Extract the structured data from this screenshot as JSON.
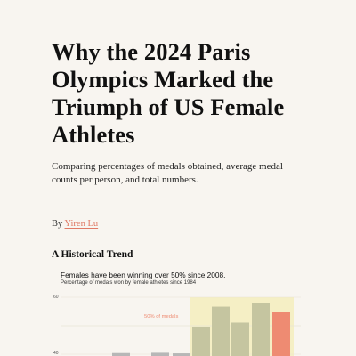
{
  "article": {
    "headline": "Why the 2024 Paris Olympics Marked the Triumph of US Female Athletes",
    "dek": "Comparing percentages of medals obtained, average medal counts per person, and total numbers.",
    "byline_prefix": "By",
    "author": "Yiren Lu"
  },
  "section": {
    "title": "A Historical Trend"
  },
  "chart": {
    "title": "Females have been winning over 50% since 2008.",
    "subtitle": "Percentage of medals won by female athletes since 1984",
    "annotation": "50% of medals",
    "colors": {
      "highlight_band": "#f5efc5",
      "bar_default": "#b7b7b7",
      "bar_over_50": "#c5c5a0",
      "bar_2024": "#ee8b72",
      "reference_line": "#e9e4d5"
    }
  },
  "chart_data": {
    "type": "bar",
    "title": "Females have been winning over 50% since 2008.",
    "subtitle": "Percentage of medals won by female athletes since 1984",
    "ylim": [
      40,
      60
    ],
    "yticks": [
      40,
      60
    ],
    "reference_value": 50,
    "reference_label": "50% of medals",
    "categories": [
      "",
      "",
      "",
      "",
      "",
      "",
      "",
      "",
      "",
      "",
      "",
      ""
    ],
    "values": [
      null,
      null,
      null,
      null,
      40.4,
      null,
      40.5,
      40.3,
      49.7,
      56.7,
      51.1,
      58.1,
      54.9
    ],
    "bars": [
      {
        "category": "",
        "value": 40.4,
        "group": "default"
      },
      {
        "category": "",
        "value": 40.5,
        "group": "default"
      },
      {
        "category": "",
        "value": 40.3,
        "group": "default"
      },
      {
        "category": "",
        "value": 49.7,
        "group": "over_50"
      },
      {
        "category": "",
        "value": 56.7,
        "group": "over_50"
      },
      {
        "category": "",
        "value": 51.1,
        "group": "over_50"
      },
      {
        "category": "",
        "value": 58.1,
        "group": "over_50"
      },
      {
        "category": "",
        "value": 54.9,
        "group": "latest"
      }
    ],
    "grid": false,
    "legend": "none"
  }
}
